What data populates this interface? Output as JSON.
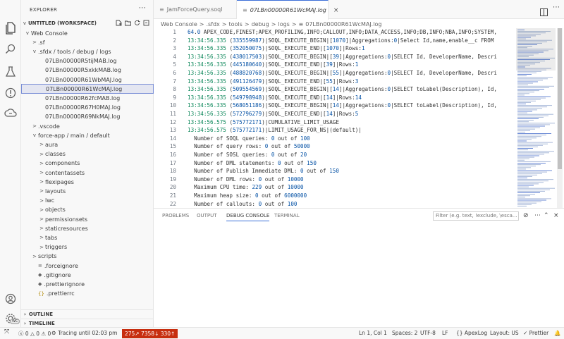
{
  "sidebar": {
    "title": "EXPLORER",
    "workspace": "UNTITLED (WORKSPACE)",
    "tree": [
      {
        "label": "Web Console",
        "indent": 0,
        "chev": "v"
      },
      {
        "label": ".sf",
        "indent": 1,
        "chev": ">"
      },
      {
        "label": ".sfdx / tools / debug / logs",
        "indent": 1,
        "chev": "v"
      },
      {
        "label": "07LBn00000R5tijMAB.log",
        "indent": 2,
        "chev": ""
      },
      {
        "label": "07LBn00000R5xkkMAB.log",
        "indent": 2,
        "chev": ""
      },
      {
        "label": "07LBn00000R61WbMAJ.log",
        "indent": 2,
        "chev": ""
      },
      {
        "label": "07LBn00000R61WcMAJ.log",
        "indent": 2,
        "chev": "",
        "selected": true
      },
      {
        "label": "07LBn00000R62fcMAB.log",
        "indent": 2,
        "chev": ""
      },
      {
        "label": "07LBn00000R67H0MAJ.log",
        "indent": 2,
        "chev": ""
      },
      {
        "label": "07LBn00000R69NkMAJ.log",
        "indent": 2,
        "chev": ""
      },
      {
        "label": ".vscode",
        "indent": 1,
        "chev": ">"
      },
      {
        "label": "force-app / main / default",
        "indent": 1,
        "chev": "v"
      },
      {
        "label": "aura",
        "indent": 2,
        "chev": ">"
      },
      {
        "label": "classes",
        "indent": 2,
        "chev": ">"
      },
      {
        "label": "components",
        "indent": 2,
        "chev": ">"
      },
      {
        "label": "contentassets",
        "indent": 2,
        "chev": ">"
      },
      {
        "label": "flexipages",
        "indent": 2,
        "chev": ">"
      },
      {
        "label": "layouts",
        "indent": 2,
        "chev": ">"
      },
      {
        "label": "lwc",
        "indent": 2,
        "chev": ">"
      },
      {
        "label": "objects",
        "indent": 2,
        "chev": ">"
      },
      {
        "label": "permissionsets",
        "indent": 2,
        "chev": ">"
      },
      {
        "label": "staticresources",
        "indent": 2,
        "chev": ">"
      },
      {
        "label": "tabs",
        "indent": 2,
        "chev": ">"
      },
      {
        "label": "triggers",
        "indent": 2,
        "chev": ">"
      },
      {
        "label": "scripts",
        "indent": 1,
        "chev": ">"
      },
      {
        "label": ".forceignore",
        "indent": 1,
        "chev": "",
        "icon": "≡"
      },
      {
        "label": ".gitignore",
        "indent": 1,
        "chev": "",
        "icon": "◆"
      },
      {
        "label": ".prettierignore",
        "indent": 1,
        "chev": "",
        "icon": "◆"
      },
      {
        "label": ".prettierrc",
        "indent": 1,
        "chev": "",
        "icon": "{}"
      }
    ],
    "outline": "OUTLINE",
    "timeline": "TIMELINE"
  },
  "tabs": [
    {
      "label": "JamForceQuery.soql",
      "active": false
    },
    {
      "label": "07LBn00000R61WcMAJ.log",
      "active": true
    }
  ],
  "breadcrumb": [
    "Web Console",
    ">",
    ".sfdx",
    ">",
    "tools",
    ">",
    "debug",
    ">",
    "logs",
    ">",
    "≡",
    "07LBn00000R61WcMAJ.log"
  ],
  "editor": {
    "lines": [
      {
        "n": "1",
        "t": "",
        "rest": "64.0 APEX_CODE,FINEST;APEX_PROFILING,INFO;CALLOUT,INFO;DATA_ACCESS,INFO;DB,INFO;NBA,INFO;SYSTEM,"
      },
      {
        "n": "2",
        "t": "13:34:56.335",
        "rest": " (335559987)|SOQL_EXECUTE_BEGIN|[1070]|Aggregations:0|Select Id,name,enable__c FROM"
      },
      {
        "n": "3",
        "t": "13:34:56.335",
        "rest": " (352050075)|SOQL_EXECUTE_END|[1070]|Rows:1"
      },
      {
        "n": "4",
        "t": "13:34:56.335",
        "rest": " (438017503)|SOQL_EXECUTE_BEGIN|[39]|Aggregations:0|SELECT Id, DeveloperName, Descri"
      },
      {
        "n": "5",
        "t": "13:34:56.335",
        "rest": " (445180640)|SOQL_EXECUTE_END|[39]|Rows:1"
      },
      {
        "n": "6",
        "t": "13:34:56.335",
        "rest": " (488820768)|SOQL_EXECUTE_BEGIN|[55]|Aggregations:0|SELECT Id, DeveloperName, Descri"
      },
      {
        "n": "7",
        "t": "13:34:56.335",
        "rest": " (491126479)|SOQL_EXECUTE_END|[55]|Rows:3"
      },
      {
        "n": "8",
        "t": "13:34:56.335",
        "rest": " (509554569)|SOQL_EXECUTE_BEGIN|[14]|Aggregations:0|SELECT toLabel(Description), Id,"
      },
      {
        "n": "9",
        "t": "13:34:56.335",
        "rest": " (549798948)|SOQL_EXECUTE_END|[14]|Rows:14"
      },
      {
        "n": "10",
        "t": "13:34:56.335",
        "rest": " (568051186)|SOQL_EXECUTE_BEGIN|[14]|Aggregations:0|SELECT toLabel(Description), Id,"
      },
      {
        "n": "11",
        "t": "13:34:56.335",
        "rest": " (572796279)|SOQL_EXECUTE_END|[14]|Rows:5"
      },
      {
        "n": "12",
        "t": "13:34:56.575",
        "rest": " (575772171)|CUMULATIVE_LIMIT_USAGE"
      },
      {
        "n": "13",
        "t": "13:34:56.575",
        "rest": " (575772171)|LIMIT_USAGE_FOR_NS|(default)|"
      },
      {
        "n": "14",
        "t": "",
        "rest": "  Number of SOQL queries: 0 out of 100"
      },
      {
        "n": "15",
        "t": "",
        "rest": "  Number of query rows: 0 out of 50000"
      },
      {
        "n": "16",
        "t": "",
        "rest": "  Number of SOSL queries: 0 out of 20"
      },
      {
        "n": "17",
        "t": "",
        "rest": "  Number of DML statements: 0 out of 150"
      },
      {
        "n": "18",
        "t": "",
        "rest": "  Number of Publish Immediate DML: 0 out of 150"
      },
      {
        "n": "19",
        "t": "",
        "rest": "  Number of DML rows: 0 out of 10000"
      },
      {
        "n": "20",
        "t": "",
        "rest": "  Maximum CPU time: 229 out of 10000"
      },
      {
        "n": "21",
        "t": "",
        "rest": "  Maximum heap size: 0 out of 6000000"
      },
      {
        "n": "22",
        "t": "",
        "rest": "  Number of callouts: 0 out of 100"
      }
    ]
  },
  "panel": {
    "tabs": [
      "PROBLEMS",
      "OUTPUT",
      "DEBUG CONSOLE",
      "TERMINAL"
    ],
    "active": "DEBUG CONSOLE",
    "filter_placeholder": "Filter (e.g. text, !exclude, \\esca..."
  },
  "status": {
    "errors": "0",
    "warnings": "0",
    "info": "0",
    "tracing": "Tracing until 02:03 pm",
    "badge": "275↗ 7358↓ 330↑",
    "position": "Ln 1, Col 1",
    "spaces": "Spaces: 2",
    "encoding": "UTF-8",
    "eol": "LF",
    "language": "{} ApexLog",
    "layout": "Layout: US",
    "prettier": "✓ Prettier"
  },
  "colors": {
    "accent": "#3c6fd8",
    "timestamp": "#098658",
    "error_badge": "#c72e0f"
  }
}
